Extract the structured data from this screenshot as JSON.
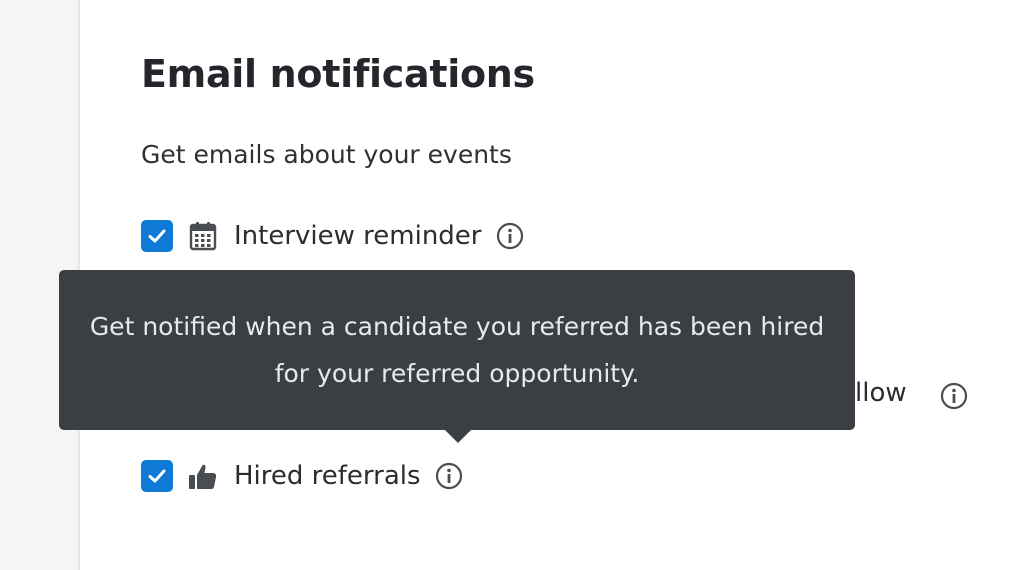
{
  "section": {
    "title": "Email notifications",
    "subtitle": "Get emails about your events"
  },
  "items": [
    {
      "label": "Interview reminder",
      "checked": true,
      "icon": "calendar-icon"
    },
    {
      "label_partial": "llow",
      "icon": "info-icon"
    },
    {
      "label": "Hired referrals",
      "checked": true,
      "icon": "thumbs-up-icon"
    }
  ],
  "tooltip": {
    "text": "Get notified when a candidate you referred has been hired for your referred opportunity."
  },
  "colors": {
    "checkbox": "#0e7ad6",
    "tooltip_bg": "#3b3e42",
    "text": "#2b2d31"
  }
}
